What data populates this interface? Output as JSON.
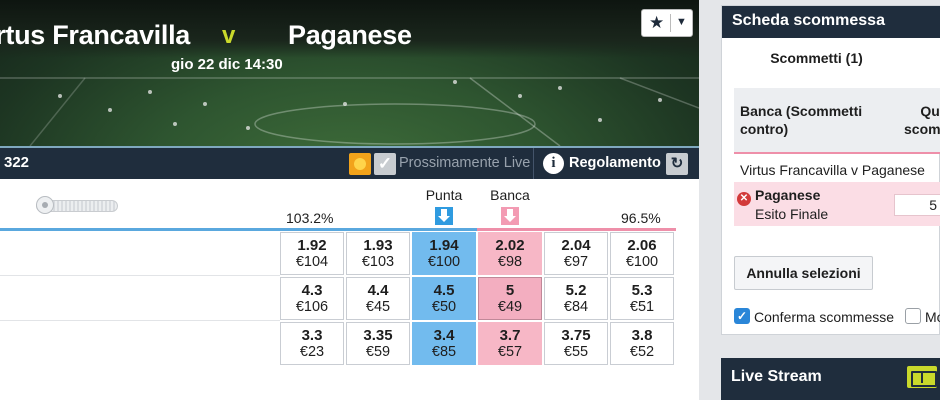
{
  "event": {
    "home": "irtus Francavilla",
    "vs": "v",
    "away": "Paganese",
    "datetime": "gio 22 dic 14:30"
  },
  "favorite": {
    "icon": "star-icon",
    "dropdown_icon": "chevron-down-icon"
  },
  "market_bar": {
    "matched_partial": "322",
    "coming_soon_live": "Prossimamente Live",
    "rules": "Regolamento"
  },
  "market": {
    "back_overround": "103.2%",
    "lay_overround": "96.5%",
    "back_label": "Punta",
    "lay_label": "Banca",
    "rows": [
      {
        "prices": [
          {
            "odds": "1.92",
            "size": "€104"
          },
          {
            "odds": "1.93",
            "size": "€103"
          },
          {
            "odds": "1.94",
            "size": "€100"
          },
          {
            "odds": "2.02",
            "size": "€98"
          },
          {
            "odds": "2.04",
            "size": "€97"
          },
          {
            "odds": "2.06",
            "size": "€100"
          }
        ]
      },
      {
        "prices": [
          {
            "odds": "4.3",
            "size": "€106"
          },
          {
            "odds": "4.4",
            "size": "€45"
          },
          {
            "odds": "4.5",
            "size": "€50"
          },
          {
            "odds": "5",
            "size": "€49"
          },
          {
            "odds": "5.2",
            "size": "€84"
          },
          {
            "odds": "5.3",
            "size": "€51"
          }
        ]
      },
      {
        "prices": [
          {
            "odds": "3.3",
            "size": "€23"
          },
          {
            "odds": "3.35",
            "size": "€59"
          },
          {
            "odds": "3.4",
            "size": "€85"
          },
          {
            "odds": "3.7",
            "size": "€57"
          },
          {
            "odds": "3.75",
            "size": "€55"
          },
          {
            "odds": "3.8",
            "size": "€52"
          }
        ]
      }
    ]
  },
  "betslip": {
    "title": "Scheda scommessa",
    "tab": "Scommetti (1)",
    "col_a": "Banca (Scommetti contro)",
    "col_b_1": "Quot",
    "col_b_2": "scomm",
    "match": "Virtus Francavilla v Paganese",
    "selection": "Paganese",
    "market": "Esito Finale",
    "odds_value": "5",
    "clear_button": "Annulla selezioni",
    "confirm_label": "Conferma scommesse",
    "other_label": "Mo"
  },
  "live_stream": {
    "title": "Live Stream"
  },
  "colors": {
    "back": "#72bbee",
    "lay": "#f7b7c6",
    "header": "#1f2d3d",
    "accent": "#c9d92b"
  }
}
